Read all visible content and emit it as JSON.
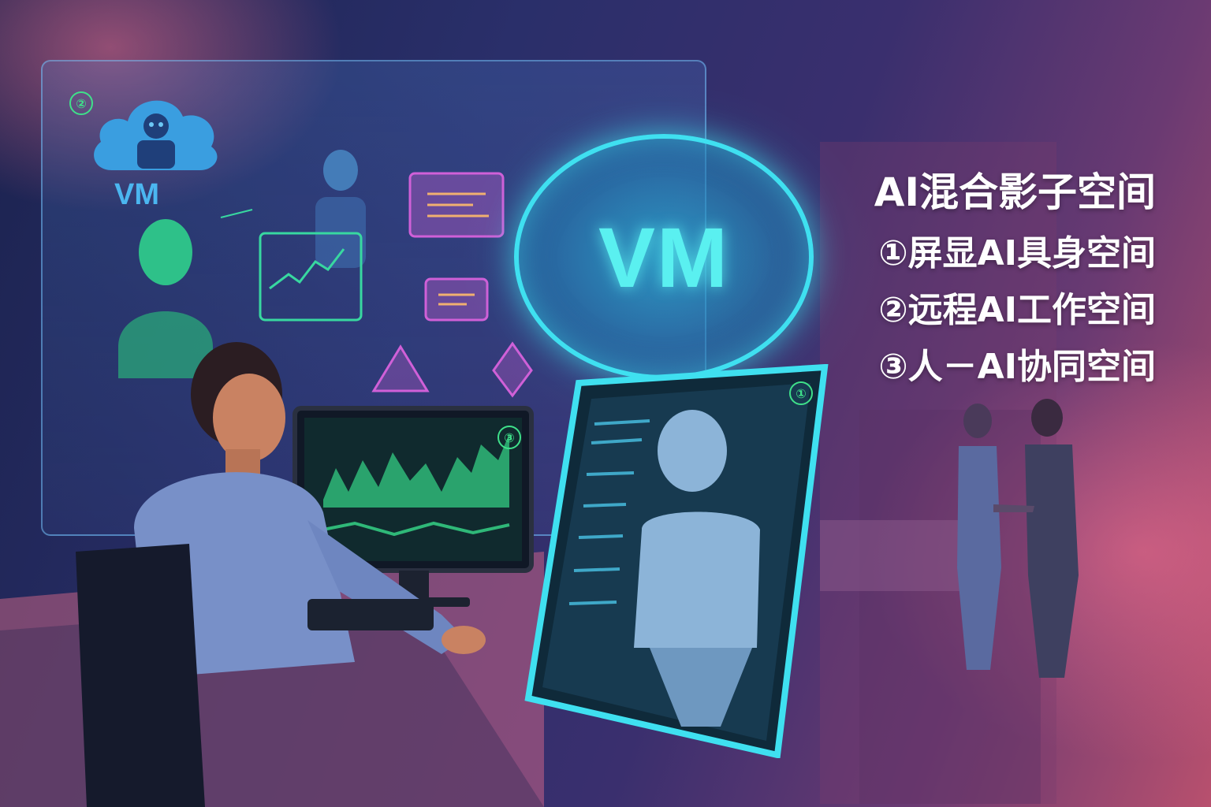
{
  "title": "AI混合影子空间",
  "items": [
    "①屏显AI具身空间",
    "②远程AI工作空间",
    "③人－AI协同空间"
  ],
  "cloud_label": "VM",
  "bubble_label": "VM",
  "badges": {
    "remote": "②",
    "monitor": "③",
    "screen": "①"
  },
  "colors": {
    "accent_cyan": "#3fe0f0",
    "badge_green": "#3fe08a",
    "cloud_blue": "#4bb6f0",
    "title_white": "#ffffff",
    "magenta_card": "#d060d8"
  }
}
